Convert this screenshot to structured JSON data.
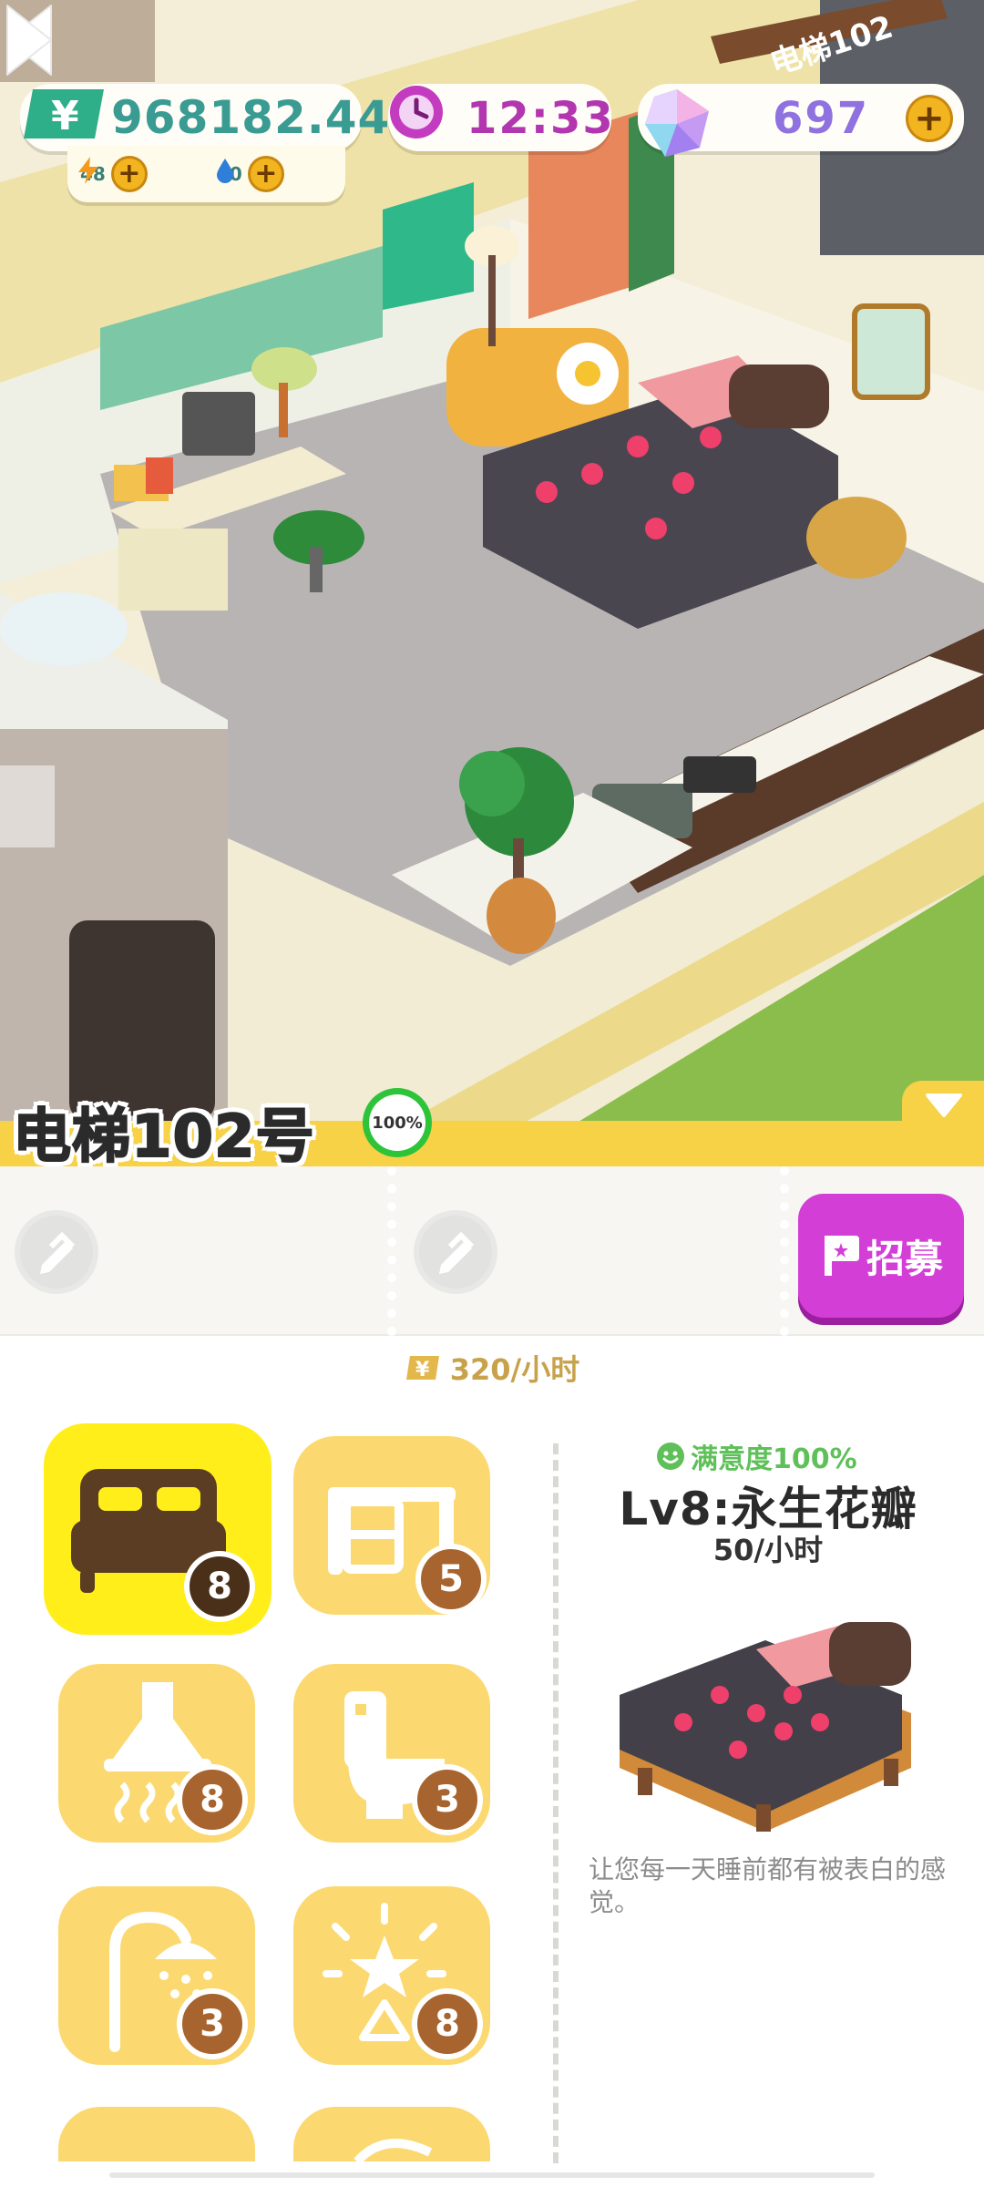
{
  "hud": {
    "money": "968182.44",
    "energy": "48",
    "water": "40",
    "timer": "12:33",
    "gems": "697"
  },
  "room": {
    "name": "电梯102号",
    "sign": "电梯102",
    "satisfaction": "100%",
    "income": "320/小时"
  },
  "recruit": {
    "label": "招募"
  },
  "furniture": [
    {
      "icon": "bed-icon",
      "level": "8",
      "selected": true
    },
    {
      "icon": "desk-icon",
      "level": "5"
    },
    {
      "icon": "range-hood-icon",
      "level": "8"
    },
    {
      "icon": "toilet-icon",
      "level": "3"
    },
    {
      "icon": "shower-icon",
      "level": "3"
    },
    {
      "icon": "lamp-icon",
      "level": "8"
    }
  ],
  "detail": {
    "satisfaction": "满意度100%",
    "name": "Lv8:永生花瓣",
    "rate": "50/小时",
    "description": "让您每一天睡前都有被表白的感觉。"
  },
  "colors": {
    "accent_yellow": "#f7d146",
    "tile_yellow": "#fbd970",
    "selected_tile": "#ffee1a",
    "recruit_purple": "#d33ed6",
    "money_teal": "#3a9b93",
    "timer_purple": "#b236b0",
    "gem_purple": "#8f72e0"
  }
}
